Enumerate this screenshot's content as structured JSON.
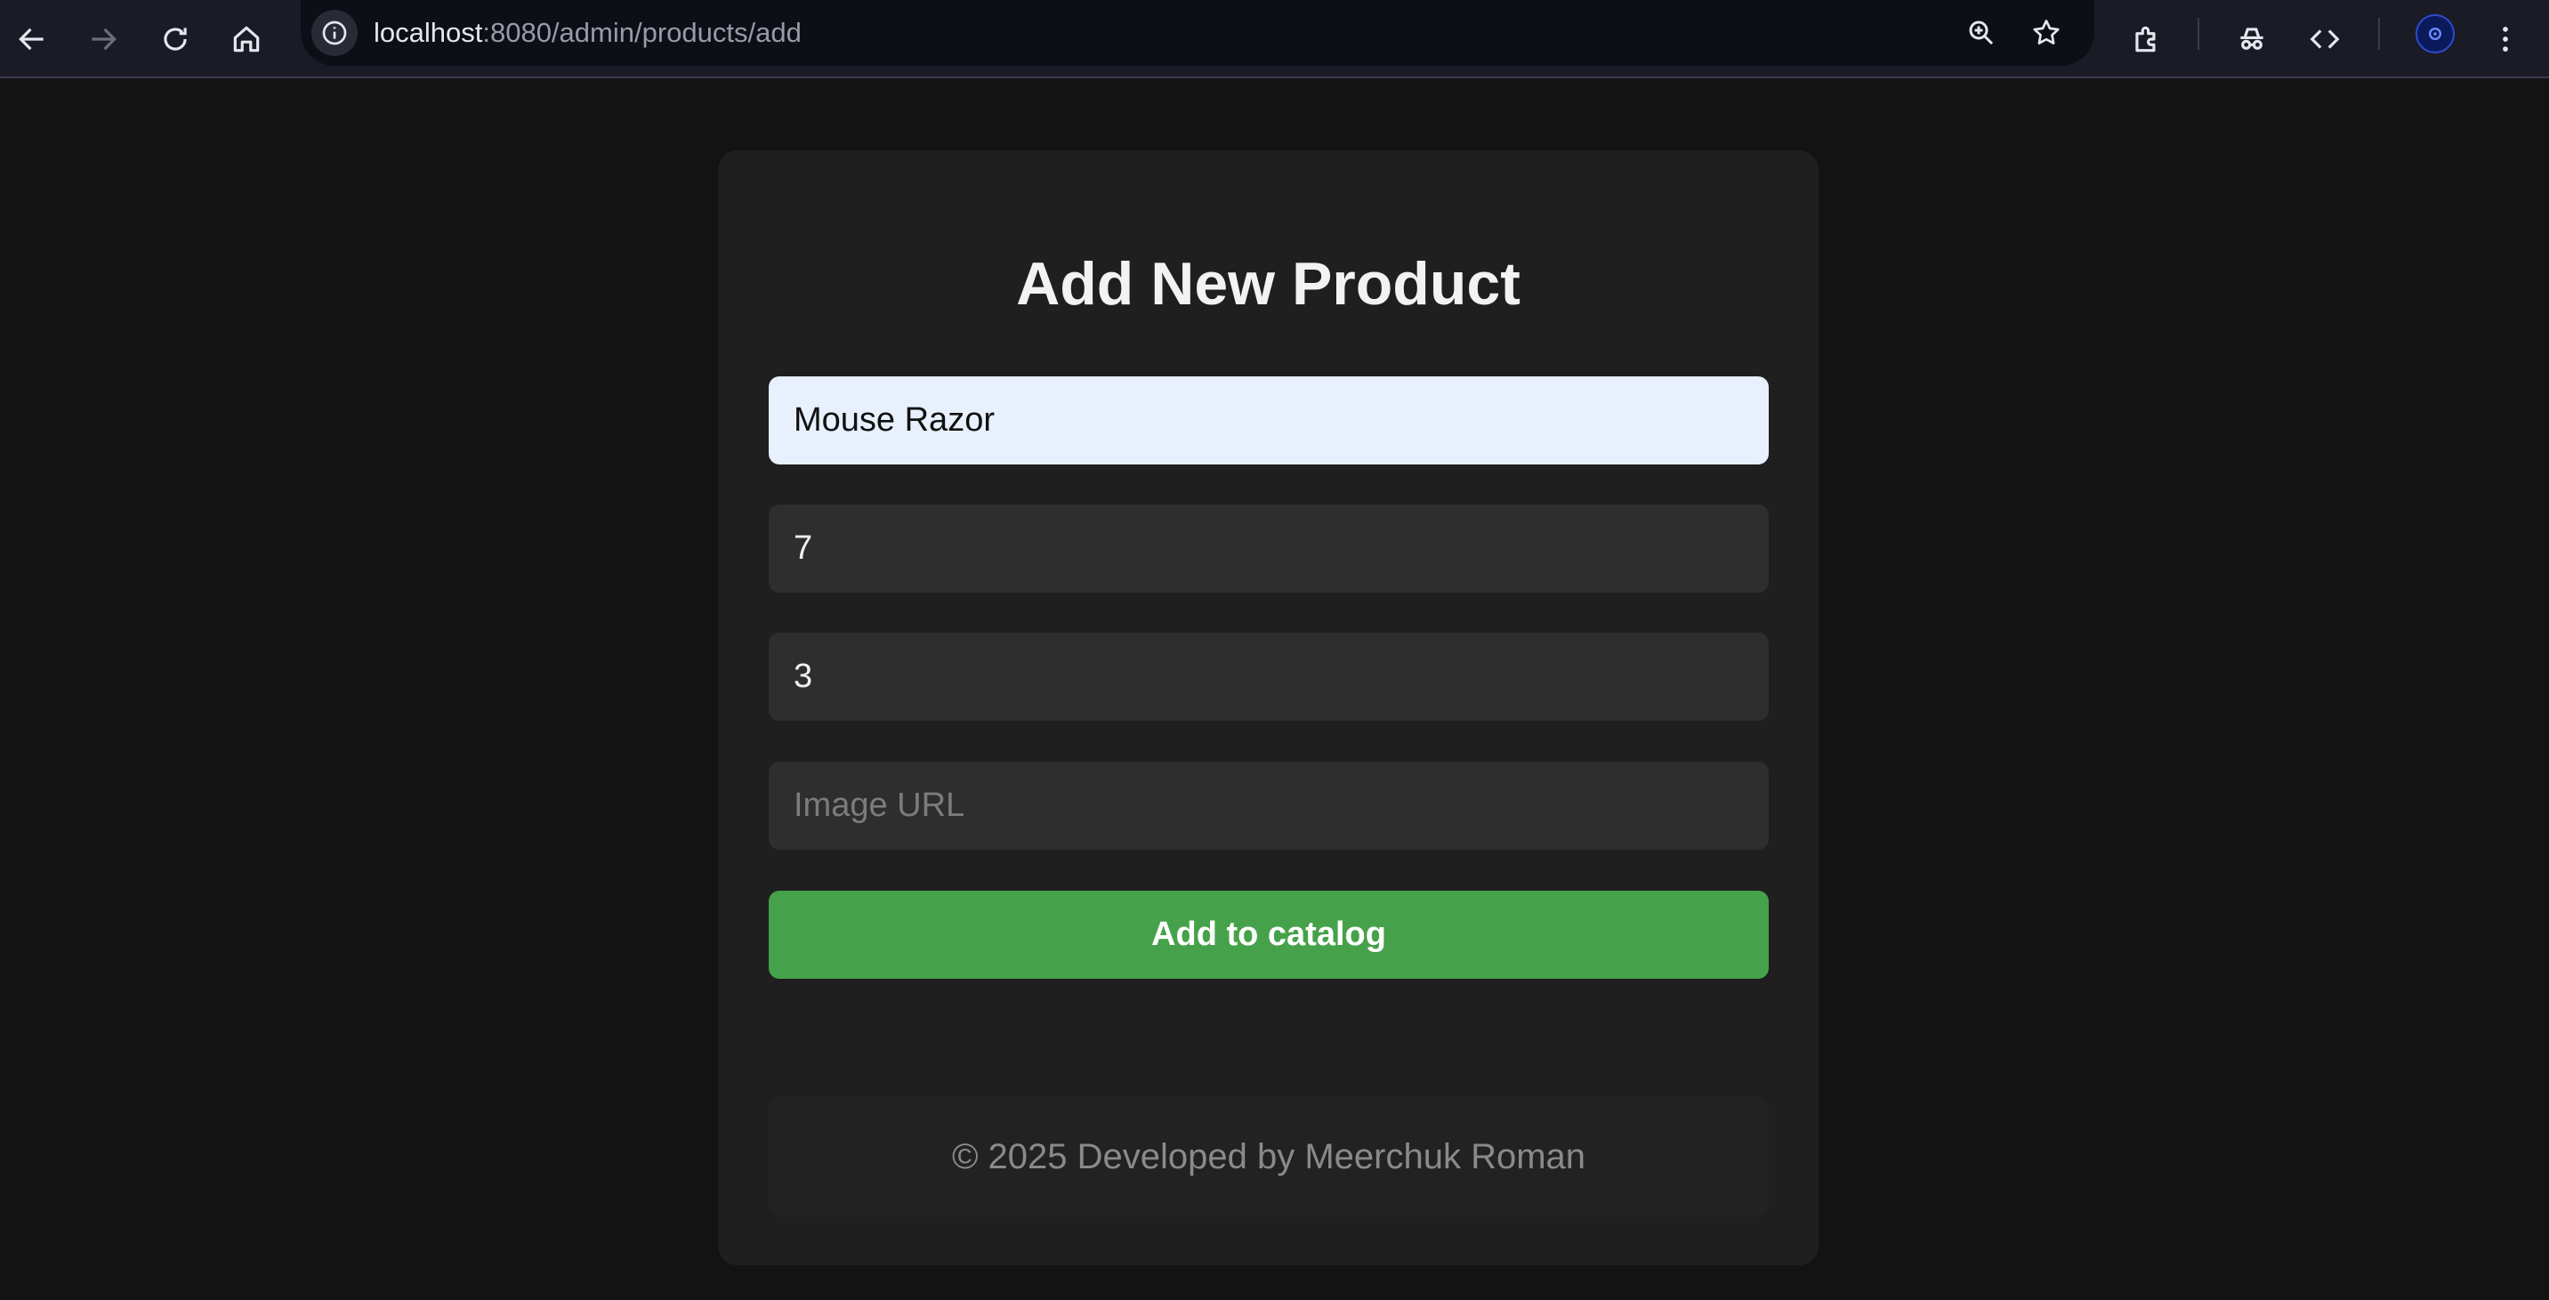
{
  "browser": {
    "url_host": "localhost",
    "url_path": ":8080/admin/products/add",
    "icons": [
      "back-icon",
      "forward-icon",
      "reload-icon",
      "home-icon",
      "site-info-icon",
      "zoom-icon",
      "bookmark-star-icon",
      "extensions-icon",
      "incognito-icon",
      "devtools-icon",
      "profile-avatar",
      "menu-icon"
    ]
  },
  "form": {
    "title": "Add New Product",
    "name_value": "Mouse Razor",
    "price_value": "7",
    "quantity_value": "3",
    "image_url_value": "",
    "image_url_placeholder": "Image URL",
    "submit_label": "Add to catalog"
  },
  "footer": {
    "text": "© 2025 Developed by Meerchuk Roman"
  },
  "colors": {
    "page_bg": "#131313",
    "card_bg": "#1f1f1f",
    "input_bg": "#2e2e2e",
    "autofill_bg": "#e8f0fe",
    "button_green": "#46a24a",
    "footer_text": "#8a8a8a"
  }
}
